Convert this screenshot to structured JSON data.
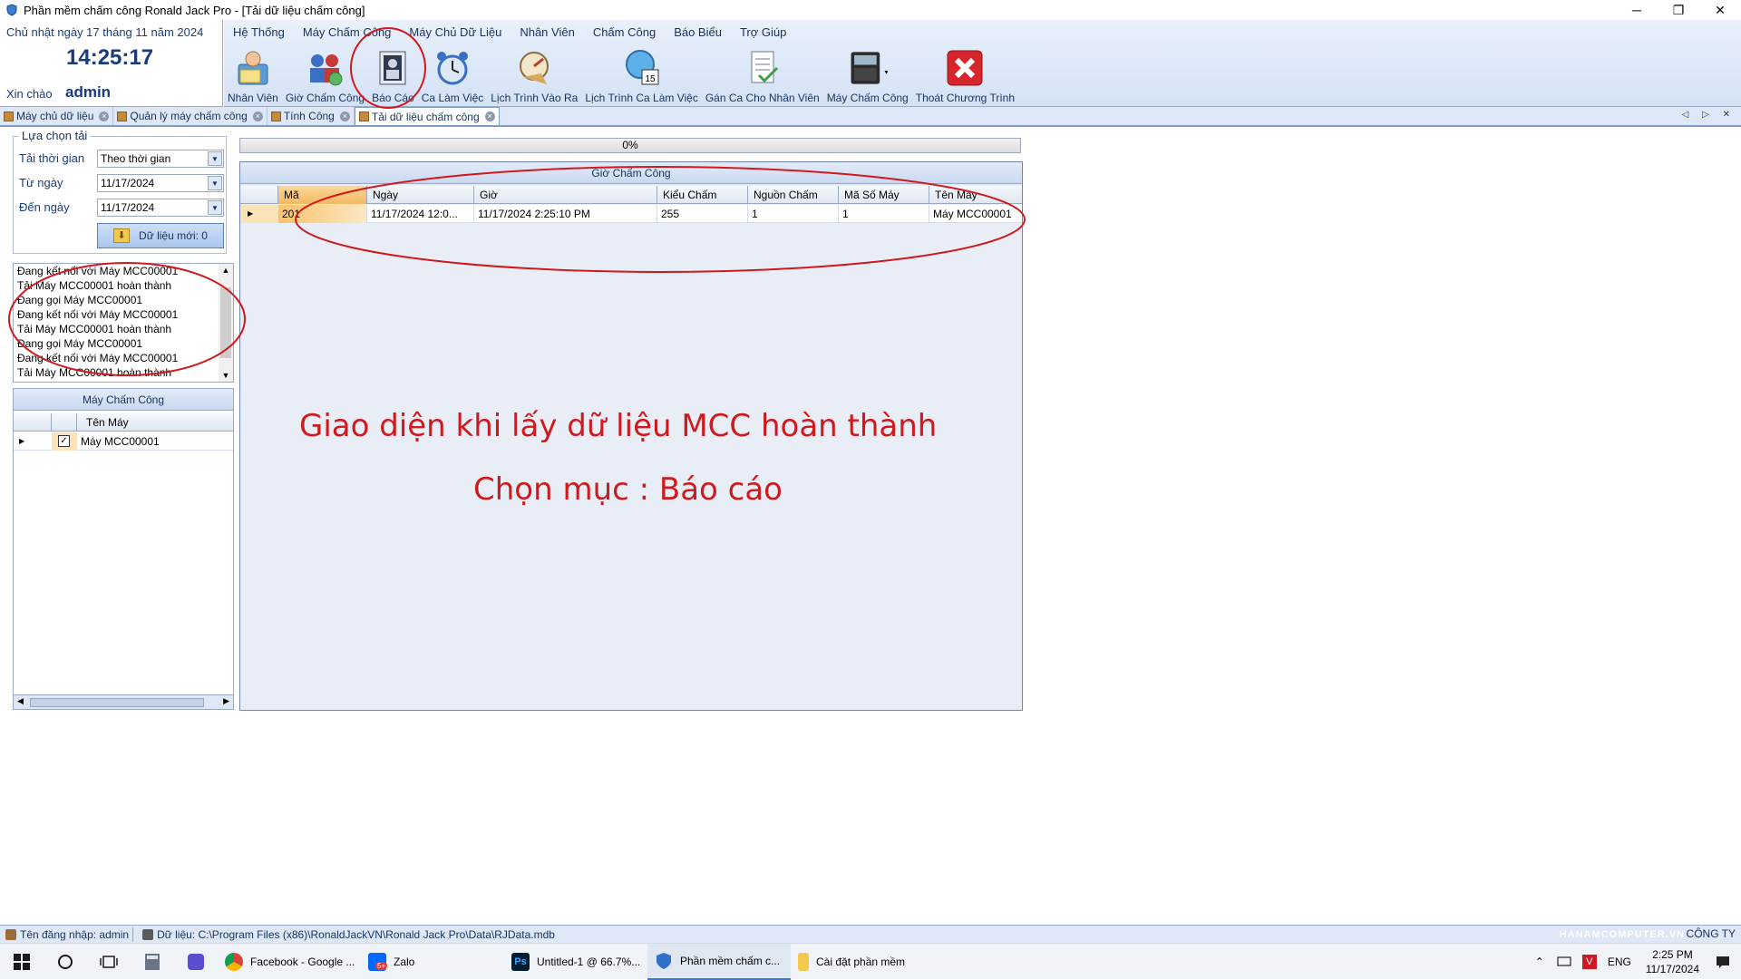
{
  "window": {
    "title": "Phần mềm chấm công Ronald Jack Pro - [Tải dữ liệu chấm công]",
    "minimize": "─",
    "restore": "❐",
    "close": "✕"
  },
  "clock": {
    "date": "Chủ nhật ngày 17 tháng 11 năm 2024",
    "time": "14:25:17",
    "greeting": "Xin chào",
    "user": "admin"
  },
  "menu": [
    "Hệ Thống",
    "Máy Chấm Công",
    "Máy Chủ Dữ Liệu",
    "Nhân Viên",
    "Chấm Công",
    "Báo Biểu",
    "Trợ Giúp"
  ],
  "toolbar": [
    {
      "label": "Nhân Viên",
      "icon": "employee-icon"
    },
    {
      "label": "Giờ Chấm Công",
      "icon": "attendance-time-icon"
    },
    {
      "label": "Báo Cáo",
      "icon": "report-icon"
    },
    {
      "label": "Ca Làm Việc",
      "icon": "alarm-clock-icon"
    },
    {
      "label": "Lịch Trình Vào Ra",
      "icon": "gauge-icon"
    },
    {
      "label": "Lịch Trình Ca Làm Việc",
      "icon": "calendar-clock-icon"
    },
    {
      "label": "Gán Ca Cho Nhân Viên",
      "icon": "assign-shift-icon"
    },
    {
      "label": "Máy Chấm Công",
      "icon": "terminal-device-icon"
    },
    {
      "label": "Thoát Chương Trình",
      "icon": "exit-icon"
    }
  ],
  "tabs": [
    {
      "label": "Máy chủ dữ liệu",
      "active": false
    },
    {
      "label": "Quản lý máy chấm công",
      "active": false
    },
    {
      "label": "Tính Công",
      "active": false
    },
    {
      "label": "Tải dữ liệu chấm công",
      "active": true
    }
  ],
  "tab_nav": "◁ ▷ ✕",
  "filter": {
    "group_title": "Lựa chọn tải",
    "mode_label": "Tải thời gian",
    "mode_value": "Theo thời gian",
    "from_label": "Từ ngày",
    "from_value": "11/17/2024",
    "to_label": "Đến ngày",
    "to_value": "11/17/2024",
    "new_data_button": "Dữ liệu mới: 0"
  },
  "log_lines": [
    "Đang kết nối với Máy MCC00001",
    "Tải Máy MCC00001 hoàn thành",
    "Đang gọi Máy MCC00001",
    "Đang kết nối với Máy MCC00001",
    "Tải Máy MCC00001 hoàn thành",
    "Đang gọi Máy MCC00001",
    "Đang kết nối với Máy MCC00001",
    "Tải Máy MCC00001 hoàn thành"
  ],
  "machines": {
    "caption": "Máy Chấm Công",
    "column": "Tên Máy",
    "rows": [
      {
        "name": "Máy MCC00001",
        "checked": true
      }
    ]
  },
  "progress": {
    "text": "0%",
    "value": 0
  },
  "records": {
    "caption": "Giờ Chấm Công",
    "columns": [
      "Mã",
      "Ngày",
      "Giờ",
      "Kiểu Chấm",
      "Nguồn Chấm",
      "Mã Số Máy",
      "Tên Máy"
    ],
    "rows": [
      [
        "201",
        "11/17/2024 12:0...",
        "11/17/2024 2:25:10 PM",
        "255",
        "1",
        "1",
        "Máy MCC00001"
      ]
    ]
  },
  "annotations": {
    "line1": "Giao diện khi lấy dữ liệu MCC hoàn thành",
    "line2": "Chọn mục : Báo cáo"
  },
  "statusbar": {
    "login": "Tên đăng nhập: admin",
    "data_path": "Dữ liệu: C:\\Program Files (x86)\\RonaldJackVN\\Ronald Jack Pro\\Data\\RJData.mdb",
    "watermark": "HANAMCOMPUTER.VN",
    "right": "CÔNG TY"
  },
  "taskbar": {
    "apps": [
      {
        "label": "Facebook - Google ...",
        "color": "#dd4b39"
      },
      {
        "label": "Zalo",
        "color": "#0068ff",
        "badge": "5+"
      },
      {
        "label": "Untitled-1 @ 66.7%...",
        "color": "#001d34"
      },
      {
        "label": "Phần mềm chấm c...",
        "color": "#2f6fc9"
      },
      {
        "label": "Cài đặt phần mềm",
        "color": "#f2c94c"
      }
    ],
    "lang": "ENG",
    "time": "2:25 PM",
    "date": "11/17/2024"
  }
}
